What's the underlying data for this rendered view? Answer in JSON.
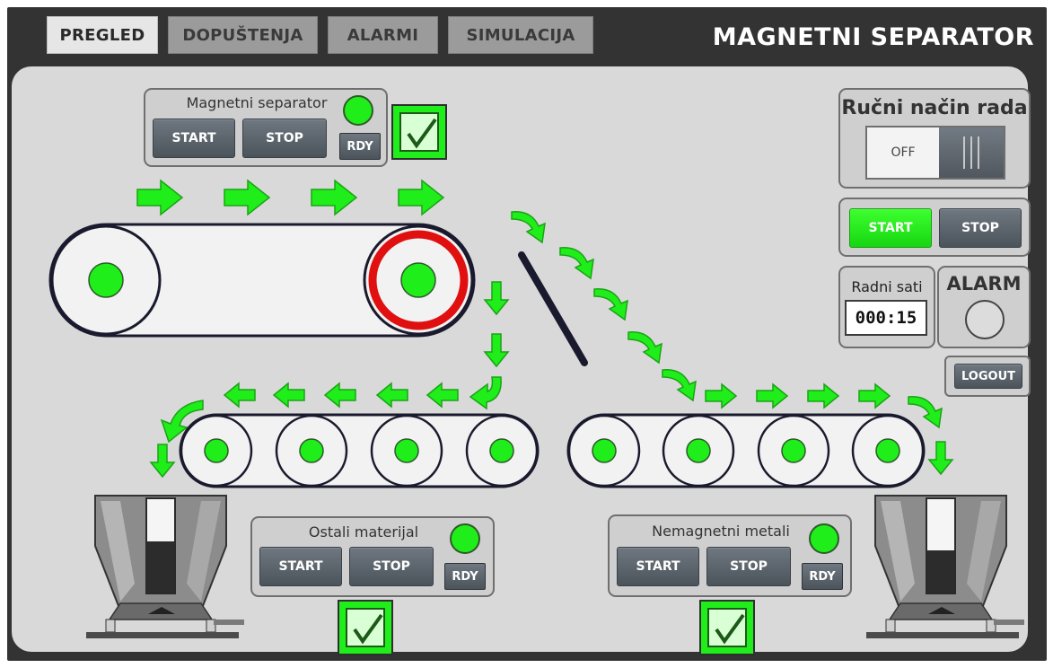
{
  "tabs": [
    {
      "label": "PREGLED",
      "active": true
    },
    {
      "label": "DOPUŠTENJA",
      "active": false
    },
    {
      "label": "ALARMI",
      "active": false
    },
    {
      "label": "SIMULACIJA",
      "active": false
    }
  ],
  "app_title": "MAGNETNI SEPARATOR",
  "magnetic_separator": {
    "title": "Magnetni separator",
    "start": "START",
    "stop": "STOP",
    "rdy": "RDY",
    "status_color": "#1fee1a",
    "enabled": true
  },
  "other_material": {
    "title": "Ostali materijal",
    "start": "START",
    "stop": "STOP",
    "rdy": "RDY",
    "status_color": "#1fee1a",
    "enabled": true
  },
  "nonmagnetic_metals": {
    "title": "Nemagnetni metali",
    "start": "START",
    "stop": "STOP",
    "rdy": "RDY",
    "status_color": "#1fee1a",
    "enabled": true
  },
  "manual_mode": {
    "title": "Ručni način rada",
    "state": "OFF"
  },
  "main_control": {
    "start": "START",
    "stop": "STOP",
    "start_color": "#1fee1a"
  },
  "work_hours": {
    "title": "Radni sati",
    "value": "000:15"
  },
  "alarm": {
    "title": "ALARM",
    "active": false
  },
  "logout": "LOGOUT",
  "hoppers": [
    {
      "name": "left-hopper",
      "level_percent": 55
    },
    {
      "name": "right-hopper",
      "level_percent": 45
    }
  ],
  "colors": {
    "accent_green": "#1fee1a",
    "drive_pulley_ring": "#e01010",
    "hmi_background": "#333333",
    "panel_background": "#d9d9d9"
  },
  "icons": [
    "flow-arrow-icon",
    "checkmark-icon",
    "status-led-icon"
  ]
}
